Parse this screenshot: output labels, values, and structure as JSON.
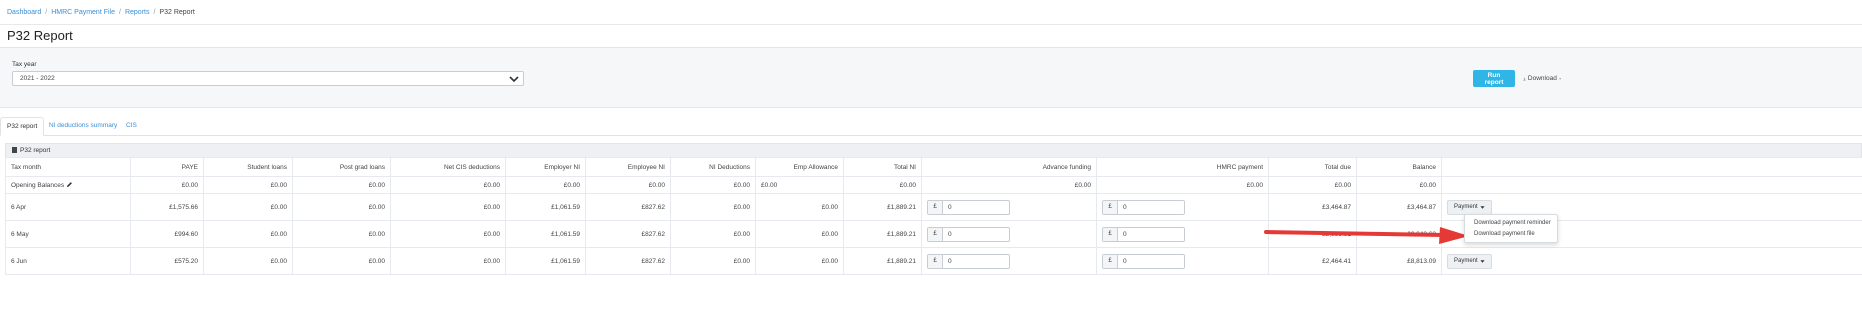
{
  "breadcrumb": [
    "Dashboard",
    "HMRC Payment File",
    "Reports",
    "P32 Report"
  ],
  "page_title": "P32 Report",
  "filter": {
    "label": "Tax year",
    "value": "2021 - 2022"
  },
  "actions": {
    "run": "Run report",
    "download": "Download"
  },
  "tabs": [
    "P32 report",
    "NI deductions summary",
    "CIS"
  ],
  "section_title": "P32 report",
  "columns": [
    "Tax month",
    "PAYE",
    "Student loans",
    "Post grad loans",
    "Net CIS deductions",
    "Employer NI",
    "Employee NI",
    "NI Deductions",
    "Emp Allowance",
    "Total NI",
    "Advance funding",
    "HMRC payment",
    "Total due",
    "Balance",
    ""
  ],
  "opening": {
    "label": "Opening Balances",
    "values": [
      "£0.00",
      "£0.00",
      "£0.00",
      "£0.00",
      "£0.00",
      "£0.00",
      "£0.00",
      "£0.00",
      "£0.00",
      "£0.00",
      "£0.00",
      "£0.00",
      "£0.00"
    ]
  },
  "rows": [
    {
      "month": "6 Apr",
      "paye": "£1,575.66",
      "student": "£0.00",
      "postgrad": "£0.00",
      "cis": "£0.00",
      "empr_ni": "£1,061.59",
      "empe_ni": "£827.62",
      "ni_ded": "£0.00",
      "emp_allow": "£0.00",
      "total_ni": "£1,889.21",
      "advance": "0",
      "hmrc": "0",
      "total_due": "£3,464.87",
      "balance": "£3,464.87",
      "pay": "Payment"
    },
    {
      "month": "6 May",
      "paye": "£994.60",
      "student": "£0.00",
      "postgrad": "£0.00",
      "cis": "£0.00",
      "empr_ni": "£1,061.59",
      "empe_ni": "£827.62",
      "ni_ded": "£0.00",
      "emp_allow": "£0.00",
      "total_ni": "£1,889.21",
      "advance": "0",
      "hmrc": "0",
      "total_due": "£2,883.81",
      "balance": "£6,348.68",
      "pay": ""
    },
    {
      "month": "6 Jun",
      "paye": "£575.20",
      "student": "£0.00",
      "postgrad": "£0.00",
      "cis": "£0.00",
      "empr_ni": "£1,061.59",
      "empe_ni": "£827.62",
      "ni_ded": "£0.00",
      "emp_allow": "£0.00",
      "total_ni": "£1,889.21",
      "advance": "0",
      "hmrc": "0",
      "total_due": "£2,464.41",
      "balance": "£8,813.09",
      "pay": "Payment"
    }
  ],
  "currency_symbol": "£",
  "payment_menu": [
    "Download payment reminder",
    "Download payment file"
  ],
  "colors": {
    "accent": "#2fb6e6",
    "link": "#3a8fd6",
    "arrow": "#e53935"
  }
}
